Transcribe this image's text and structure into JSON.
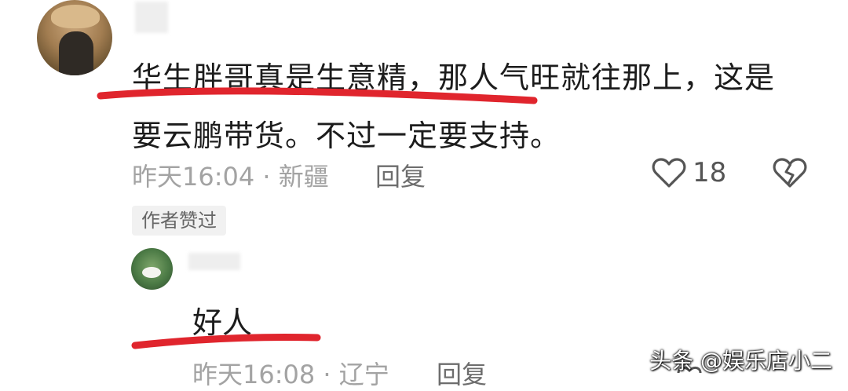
{
  "comment": {
    "text_line1": "华生胖哥真是生意精，那人气旺就往那上，这是",
    "text_line2": "要云鹏带货。不过一定要支持。",
    "time": "昨天16:04",
    "location": "新疆",
    "reply_label": "回复",
    "like_count": "18",
    "badge": "作者赞过",
    "icons": [
      "user-avatar",
      "heart-icon",
      "broken-heart-icon"
    ]
  },
  "reply": {
    "text": "好人",
    "time": "昨天16:08",
    "location": "辽宁",
    "reply_label": "回复",
    "icons": [
      "user-avatar"
    ]
  },
  "watermark": "头条 @娱乐店小二",
  "colors": {
    "underline": "#e0252d",
    "text": "#1c1c1c",
    "meta": "#a3a3a3"
  }
}
